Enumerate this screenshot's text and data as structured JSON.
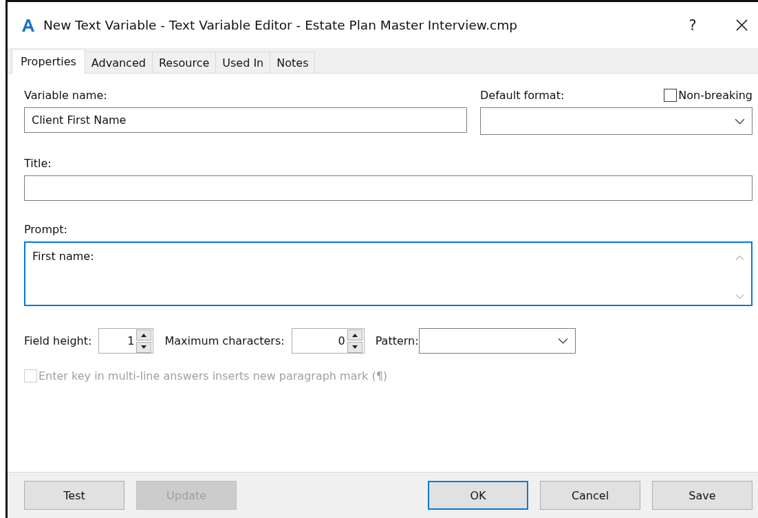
{
  "window": {
    "title": "New Text Variable - Text Variable Editor - Estate Plan Master Interview.cmp",
    "help": "?"
  },
  "tabs": [
    {
      "label": "Properties",
      "selected": true
    },
    {
      "label": "Advanced",
      "selected": false
    },
    {
      "label": "Resource",
      "selected": false
    },
    {
      "label": "Used In",
      "selected": false
    },
    {
      "label": "Notes",
      "selected": false
    }
  ],
  "variable_name": {
    "label": "Variable name:",
    "value": "Client First Name"
  },
  "default_format": {
    "label": "Default format:"
  },
  "non_breaking": {
    "label": "Non-breaking",
    "checked": false
  },
  "title": {
    "label": "Title:"
  },
  "prompt": {
    "label": "Prompt:",
    "value": "First name:",
    "focused": true
  },
  "field_height": {
    "label": "Field height:",
    "value": "1"
  },
  "maximum_characters": {
    "label": "Maximum characters:",
    "value": "0"
  },
  "pattern": {
    "label": "Pattern:"
  },
  "enter_key_option": {
    "label": "Enter key in multi-line answers inserts new paragraph mark (¶)",
    "checked": false,
    "disabled": true
  },
  "left_buttons": [
    {
      "label": "Test",
      "disabled": false,
      "default": false
    },
    {
      "label": "Update",
      "disabled": true,
      "default": false
    }
  ],
  "right_buttons": [
    {
      "label": "OK",
      "disabled": false,
      "default": true
    },
    {
      "label": "Cancel",
      "disabled": false,
      "default": false
    },
    {
      "label": "Save",
      "disabled": false,
      "default": false
    }
  ]
}
